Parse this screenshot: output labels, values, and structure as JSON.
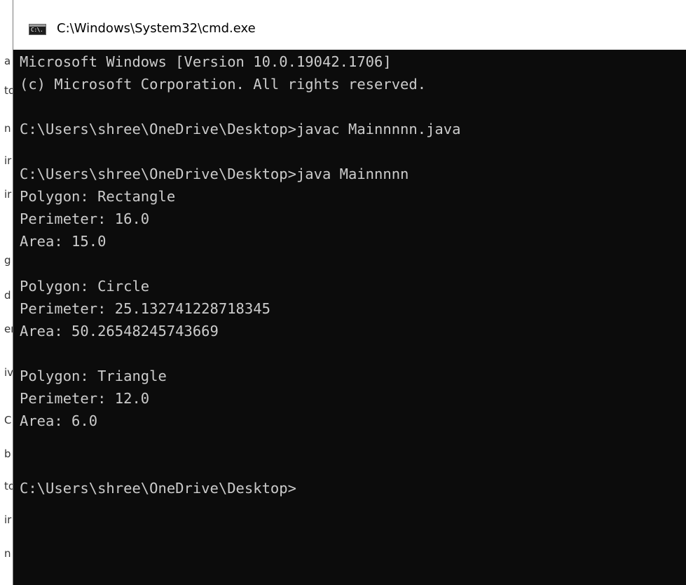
{
  "window": {
    "title": "C:\\Windows\\System32\\cmd.exe",
    "icon": "cmd-console-icon",
    "icon_text": "C:\\."
  },
  "background_fragments": [
    "a",
    "to",
    "n",
    "ir",
    "ir",
    "g",
    "d",
    "er",
    "iv",
    "C",
    "b",
    "to",
    "ir",
    "n"
  ],
  "console": {
    "lines": [
      "Microsoft Windows [Version 10.0.19042.1706]",
      "(c) Microsoft Corporation. All rights reserved.",
      "",
      "C:\\Users\\shree\\OneDrive\\Desktop>javac Mainnnnn.java",
      "",
      "C:\\Users\\shree\\OneDrive\\Desktop>java Mainnnnn",
      "Polygon: Rectangle",
      "Perimeter: 16.0",
      "Area: 15.0",
      "",
      "Polygon: Circle",
      "Perimeter: 25.132741228718345",
      "Area: 50.26548245743669",
      "",
      "Polygon: Triangle",
      "Perimeter: 12.0",
      "Area: 6.0",
      "",
      "",
      "C:\\Users\\shree\\OneDrive\\Desktop>"
    ]
  },
  "colors": {
    "console_background": "#0c0c0c",
    "console_text": "#cccccc",
    "titlebar_background": "#ffffff"
  }
}
